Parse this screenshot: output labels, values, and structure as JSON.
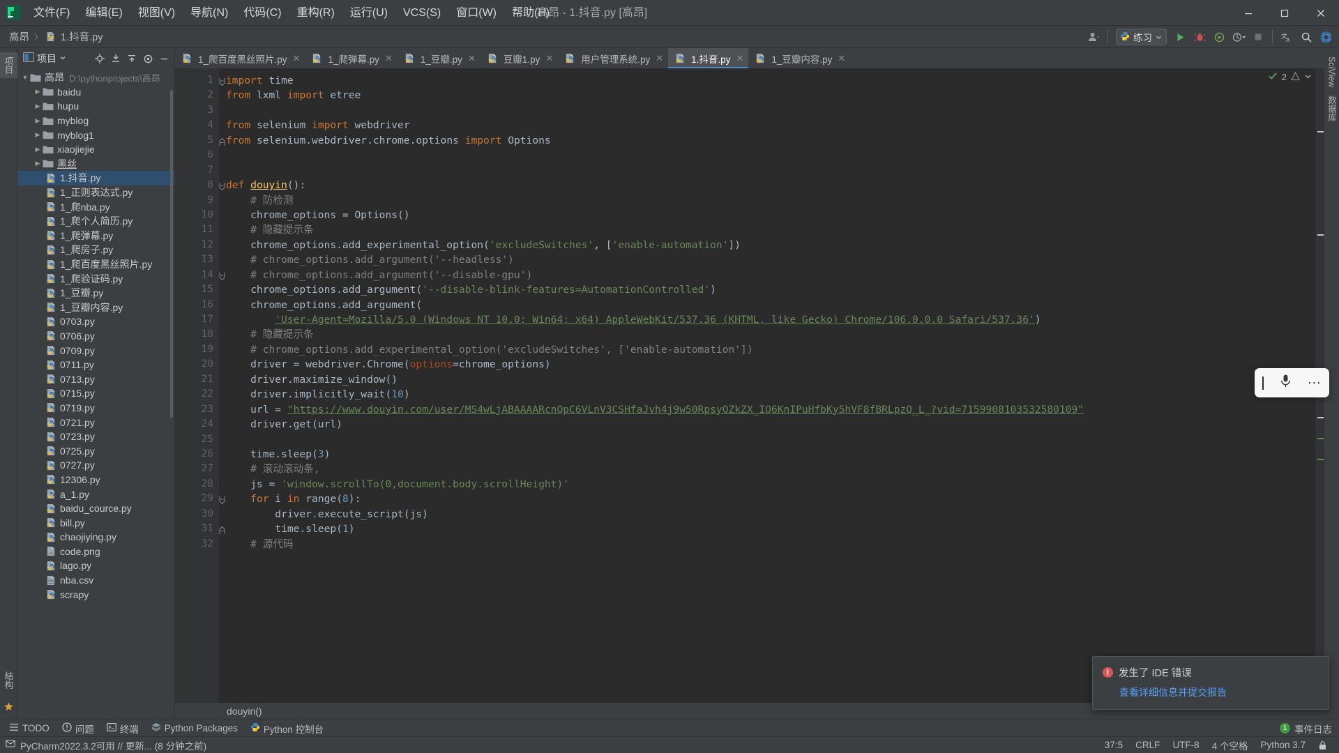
{
  "window": {
    "title": "高昂 - 1.抖音.py [高昂]",
    "app_icon": "pycharm-logo-icon",
    "minimize_label": "最小化",
    "maximize_label": "最大化",
    "close_label": "关闭"
  },
  "menu": [
    {
      "label": "文件(F)",
      "name": "menu-file"
    },
    {
      "label": "编辑(E)",
      "name": "menu-edit"
    },
    {
      "label": "视图(V)",
      "name": "menu-view"
    },
    {
      "label": "导航(N)",
      "name": "menu-navigate"
    },
    {
      "label": "代码(C)",
      "name": "menu-code"
    },
    {
      "label": "重构(R)",
      "name": "menu-refactor"
    },
    {
      "label": "运行(U)",
      "name": "menu-run"
    },
    {
      "label": "VCS(S)",
      "name": "menu-vcs"
    },
    {
      "label": "窗口(W)",
      "name": "menu-window"
    },
    {
      "label": "帮助(H)",
      "name": "menu-help"
    }
  ],
  "breadcrumb": {
    "project": "高昂",
    "file": "1.抖音.py",
    "separator": "〉"
  },
  "toolbar": {
    "run_config": "练习",
    "run_config_icon": "python-icon",
    "account_icon": "account-icon",
    "run_icon": "run-icon",
    "debug_icon": "debug-icon",
    "coverage_icon": "coverage-run-icon",
    "profile_icon": "profile-dropdown-icon",
    "stop_icon": "stop-icon",
    "translate_icon": "translate-icon",
    "search_icon": "search-everywhere-icon",
    "settings_icon": "gear-icon"
  },
  "project_panel": {
    "title": "项目",
    "dropdown_icon": "chevron-down-icon",
    "tools": [
      "target-icon",
      "expand-all-icon",
      "collapse-all-icon",
      "settings-gear-icon",
      "hide-icon"
    ],
    "root": {
      "label": "高昂",
      "path": "D:\\pythonprojects\\高昂",
      "expanded": true
    },
    "folders": [
      {
        "label": "baidu"
      },
      {
        "label": "hupu"
      },
      {
        "label": "myblog"
      },
      {
        "label": "myblog1"
      },
      {
        "label": "xiaojiejie"
      },
      {
        "label": "黑丝",
        "underlined": true
      }
    ],
    "files": [
      {
        "label": "1.抖音.py",
        "type": "py",
        "selected": true
      },
      {
        "label": "1_正则表达式.py",
        "type": "py"
      },
      {
        "label": "1_爬nba.py",
        "type": "py"
      },
      {
        "label": "1_爬个人简历.py",
        "type": "py"
      },
      {
        "label": "1_爬弹幕.py",
        "type": "py"
      },
      {
        "label": "1_爬房子.py",
        "type": "py"
      },
      {
        "label": "1_爬百度黑丝照片.py",
        "type": "py"
      },
      {
        "label": "1_爬验证码.py",
        "type": "py"
      },
      {
        "label": "1_豆瓣.py",
        "type": "py"
      },
      {
        "label": "1_豆瓣内容.py",
        "type": "py"
      },
      {
        "label": "0703.py",
        "type": "py"
      },
      {
        "label": "0706.py",
        "type": "py"
      },
      {
        "label": "0709.py",
        "type": "py"
      },
      {
        "label": "0711.py",
        "type": "py"
      },
      {
        "label": "0713.py",
        "type": "py"
      },
      {
        "label": "0715.py",
        "type": "py"
      },
      {
        "label": "0719.py",
        "type": "py"
      },
      {
        "label": "0721.py",
        "type": "py"
      },
      {
        "label": "0723.py",
        "type": "py"
      },
      {
        "label": "0725.py",
        "type": "py"
      },
      {
        "label": "0727.py",
        "type": "py"
      },
      {
        "label": "12306.py",
        "type": "py"
      },
      {
        "label": "a_1.py",
        "type": "py"
      },
      {
        "label": "baidu_cource.py",
        "type": "py"
      },
      {
        "label": "bill.py",
        "type": "py"
      },
      {
        "label": "chaojiying.py",
        "type": "py"
      },
      {
        "label": "code.png",
        "type": "img"
      },
      {
        "label": "lago.py",
        "type": "py"
      },
      {
        "label": "nba.csv",
        "type": "csv"
      },
      {
        "label": "scrapy",
        "type": "py"
      }
    ]
  },
  "left_strip_tabs": [
    {
      "label": "项目",
      "name": "tool-tab-project",
      "selected": true
    },
    {
      "label": "收藏夹",
      "name": "tool-tab-favorites"
    },
    {
      "label": "结构",
      "name": "tool-tab-structure"
    }
  ],
  "right_strip_tabs": [
    {
      "label": "SciView",
      "name": "tool-tab-sciview"
    },
    {
      "label": "数据库",
      "name": "tool-tab-database"
    }
  ],
  "editor_tabs": [
    {
      "label": "1_爬百度黑丝照片.py",
      "active": false
    },
    {
      "label": "1_爬弹幕.py",
      "active": false
    },
    {
      "label": "1_豆瓣.py",
      "active": false
    },
    {
      "label": "豆瓣1.py",
      "active": false
    },
    {
      "label": "用户管理系统.py",
      "active": false
    },
    {
      "label": "1.抖音.py",
      "active": true
    },
    {
      "label": "1_豆瓣内容.py",
      "active": false
    }
  ],
  "inspection": {
    "count": "2",
    "check_icon": "inspection-ok-icon",
    "chevron_icon": "chevron-down-icon"
  },
  "editor": {
    "first_line": 1,
    "line_count": 32,
    "code_lines": [
      {
        "n": 1,
        "fold": "start",
        "html": "<span class=\"kw\">import</span> time"
      },
      {
        "n": 2,
        "html": "<span class=\"kw\">from</span> lxml <span class=\"kw\">import</span> etree"
      },
      {
        "n": 3,
        "html": ""
      },
      {
        "n": 4,
        "html": "<span class=\"kw\">from</span> selenium <span class=\"kw\">import</span> webdriver"
      },
      {
        "n": 5,
        "fold": "end",
        "html": "<span class=\"kw\">from</span> selenium.webdriver.chrome.options <span class=\"kw\">import</span> Options"
      },
      {
        "n": 6,
        "html": ""
      },
      {
        "n": 7,
        "html": ""
      },
      {
        "n": 8,
        "fold": "start",
        "html": "<span class=\"kw\">def</span> <span class=\"fn ul\">douyin</span>():"
      },
      {
        "n": 9,
        "html": "    <span class=\"cmt\"># 防检测</span>"
      },
      {
        "n": 10,
        "html": "    chrome_options = Options()"
      },
      {
        "n": 11,
        "html": "    <span class=\"cmt\"># 隐藏提示条</span>"
      },
      {
        "n": 12,
        "html": "    chrome_options.add_experimental_option(<span class=\"str\">'excludeSwitches'</span>, [<span class=\"str\">'enable-automation'</span>])"
      },
      {
        "n": 13,
        "html": "    <span class=\"cmt\"># chrome_options.add_argument('--headless')</span>"
      },
      {
        "n": 14,
        "fold": "start",
        "html": "    <span class=\"cmt\"># chrome_options.add_argument('--disable-gpu')</span>"
      },
      {
        "n": 15,
        "html": "    chrome_options.add_argument(<span class=\"str\">'--disable-blink-features=AutomationControlled'</span>)"
      },
      {
        "n": 16,
        "html": "    chrome_options.add_argument("
      },
      {
        "n": 17,
        "html": "        <span class=\"str-ul\">'User-Agent=Mozilla/5.0 (Windows NT 10.0; Win64; x64) AppleWebKit/537.36 (KHTML, like Gecko) Chrome/106.0.0.0 Safari/537.36'</span>)"
      },
      {
        "n": 18,
        "html": "    <span class=\"cmt\"># 隐藏提示条</span>"
      },
      {
        "n": 19,
        "html": "    <span class=\"cmt\"># chrome_options.add_experimental_option('excludeSwitches', ['enable-automation'])</span>"
      },
      {
        "n": 20,
        "html": "    driver = webdriver.Chrome(<span class=\"param\">options</span>=chrome_options)"
      },
      {
        "n": 21,
        "html": "    driver.maximize_window()"
      },
      {
        "n": 22,
        "html": "    driver.implicitly_wait(<span class=\"num\">10</span>)"
      },
      {
        "n": 23,
        "html": "    url = <span class=\"str-ul\">\"https://www.douyin.com/user/MS4wLjABAAAARcnQpC6VLnV3CSHfaJvh4j9w50RpsyOZkZX_IQ6KnIPuHfbKy5hVF8fBRLpzQ_L_?vid=7159908103532580109\"</span>"
      },
      {
        "n": 24,
        "html": "    driver.get(url)"
      },
      {
        "n": 25,
        "html": ""
      },
      {
        "n": 26,
        "html": "    time.sleep(<span class=\"num\">3</span>)"
      },
      {
        "n": 27,
        "html": "    <span class=\"cmt\"># 滚动滚动条,</span>"
      },
      {
        "n": 28,
        "html": "    js = <span class=\"str\">'window.scrollTo(0,document.body.scrollHeight)'</span>"
      },
      {
        "n": 29,
        "fold": "start",
        "html": "    <span class=\"kw\">for</span> i <span class=\"kw\">in</span> <span class=\"id\">range</span>(<span class=\"num\">8</span>):"
      },
      {
        "n": 30,
        "html": "        driver.execute_script(js)"
      },
      {
        "n": 31,
        "fold": "end",
        "html": "        time.sleep(<span class=\"num\">1</span>)"
      },
      {
        "n": 32,
        "html": "    <span class=\"cmt\"># 源代码</span>"
      }
    ],
    "bottom_breadcrumb": "douyin()"
  },
  "mic_widget": {
    "cursor_icon": "text-cursor-icon",
    "mic_icon": "microphone-icon",
    "more_icon": "more-options-icon"
  },
  "notification": {
    "error_icon": "error-icon",
    "title": "发生了 IDE 错误",
    "link": "查看详细信息并提交报告"
  },
  "tool_window_bar": [
    {
      "label": "TODO",
      "icon": "todo-icon",
      "name": "tool-window-todo"
    },
    {
      "label": "问题",
      "icon": "problems-icon",
      "name": "tool-window-problems"
    },
    {
      "label": "终端",
      "icon": "terminal-icon",
      "name": "tool-window-terminal"
    },
    {
      "label": "Python Packages",
      "icon": "packages-icon",
      "name": "tool-window-python-packages"
    },
    {
      "label": "Python 控制台",
      "icon": "python-console-icon",
      "name": "tool-window-python-console"
    }
  ],
  "tool_window_right": {
    "event_count": "1",
    "event_label": "事件日志"
  },
  "statusbar": {
    "message": "PyCharm2022.3.2可用 // 更新... (8 分钟之前)",
    "caret": "37:5",
    "line_sep": "CRLF",
    "encoding": "UTF-8",
    "indent": "4 个空格",
    "interpreter": "Python 3.7",
    "lock_icon": "lock-icon",
    "memory_icon": "memory-icon"
  },
  "colors": {
    "bg_chrome": "#3c3f41",
    "bg_editor": "#2b2b2b",
    "gutter": "#313335",
    "accent_blue": "#4a88c7",
    "selection": "#0d293e",
    "keyword": "#cc7832",
    "string": "#6a8759",
    "comment": "#808080",
    "number": "#6897bb",
    "function": "#ffc66d",
    "error_red": "#d95757",
    "link_blue": "#589df6"
  }
}
